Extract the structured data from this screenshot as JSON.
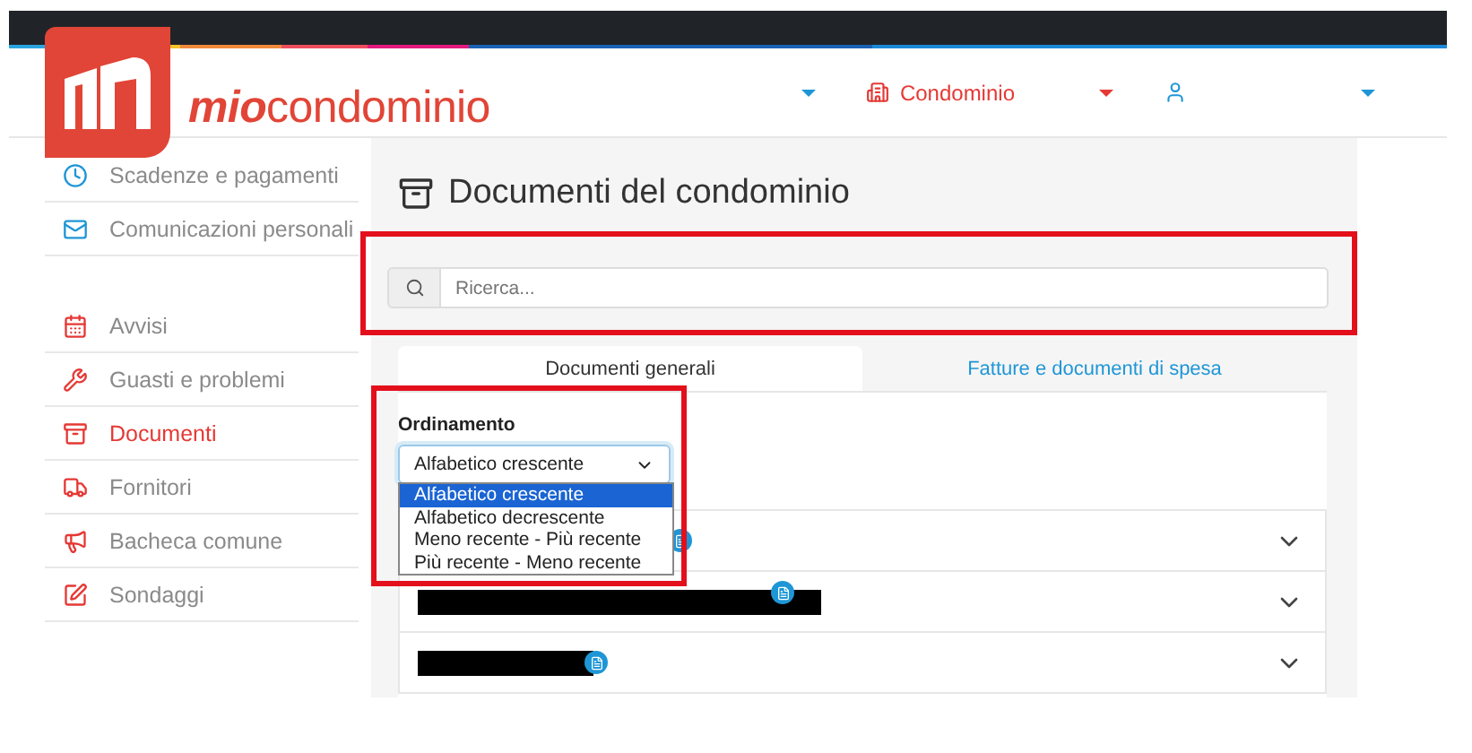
{
  "brand": {
    "prefix": "mio",
    "name": "condominio"
  },
  "header": {
    "condominium_menu": "Condominio"
  },
  "sidebar": {
    "groups": [
      {
        "items": [
          {
            "label": "Scadenze e pagamenti",
            "selected": false
          },
          {
            "label": "Comunicazioni personali",
            "selected": false
          }
        ]
      },
      {
        "items": [
          {
            "label": "Avvisi",
            "selected": false
          },
          {
            "label": "Guasti e problemi",
            "selected": false
          },
          {
            "label": "Documenti",
            "selected": true
          },
          {
            "label": "Fornitori",
            "selected": false
          },
          {
            "label": "Bacheca comune",
            "selected": false
          },
          {
            "label": "Sondaggi",
            "selected": false
          }
        ]
      }
    ]
  },
  "page": {
    "title": "Documenti del condominio"
  },
  "search": {
    "placeholder": "Ricerca..."
  },
  "tabs": [
    {
      "label": "Documenti generali",
      "selected": true
    },
    {
      "label": "Fatture e documenti di spesa",
      "selected": false
    }
  ],
  "sort": {
    "label": "Ordinamento",
    "value": "Alfabetico crescente",
    "options": [
      {
        "label": "Alfabetico crescente",
        "selected": true
      },
      {
        "label": "Alfabetico decrescente",
        "selected": false
      },
      {
        "label": "Meno recente - Più recente",
        "selected": false
      },
      {
        "label": "Più recente - Meno recente",
        "selected": false
      }
    ]
  },
  "rows": [
    {
      "redacted": false,
      "badge": true
    },
    {
      "redacted": true,
      "badge": true
    },
    {
      "redacted": true,
      "badge": true
    }
  ]
}
